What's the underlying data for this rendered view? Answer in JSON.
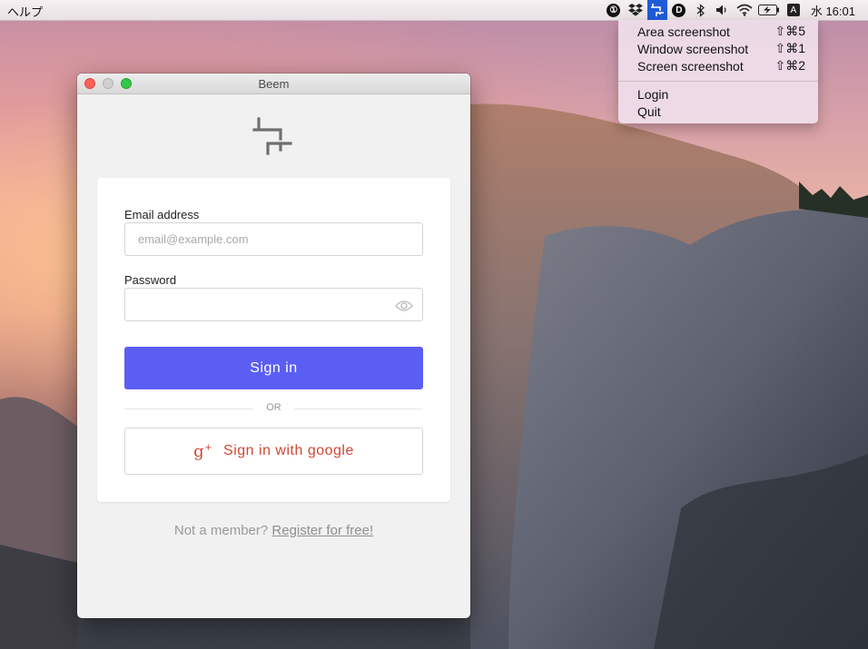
{
  "menubar": {
    "help": "ヘルプ",
    "clock": "水 16:01",
    "input_source": "A",
    "tray_icons": [
      "onepassword-icon",
      "dropbox-icon",
      "beem-crop-icon",
      "d-icon",
      "bluetooth-icon",
      "volume-icon",
      "wifi-icon",
      "battery-icon",
      "input-source-icon"
    ]
  },
  "dropdown": {
    "items": [
      {
        "label": "Area screenshot",
        "shortcut": "⇧⌘5"
      },
      {
        "label": "Window screenshot",
        "shortcut": "⇧⌘1"
      },
      {
        "label": "Screen screenshot",
        "shortcut": "⇧⌘2"
      },
      {
        "label": "Login",
        "shortcut": ""
      },
      {
        "label": "Quit",
        "shortcut": ""
      }
    ]
  },
  "window": {
    "title": "Beem",
    "email_label": "Email address",
    "email_placeholder": "email@example.com",
    "email_value": "",
    "password_label": "Password",
    "password_value": "",
    "signin_label": "Sign in",
    "or_text": "OR",
    "google_icon_text": "g",
    "google_icon_plus": "+",
    "google_label": "Sign in with google",
    "member_text": "Not a member?",
    "register_link": "Register for free!"
  },
  "colors": {
    "primary_button": "#5b5ef3",
    "google_red": "#d14836",
    "menu_highlight": "#1f5bd8"
  }
}
